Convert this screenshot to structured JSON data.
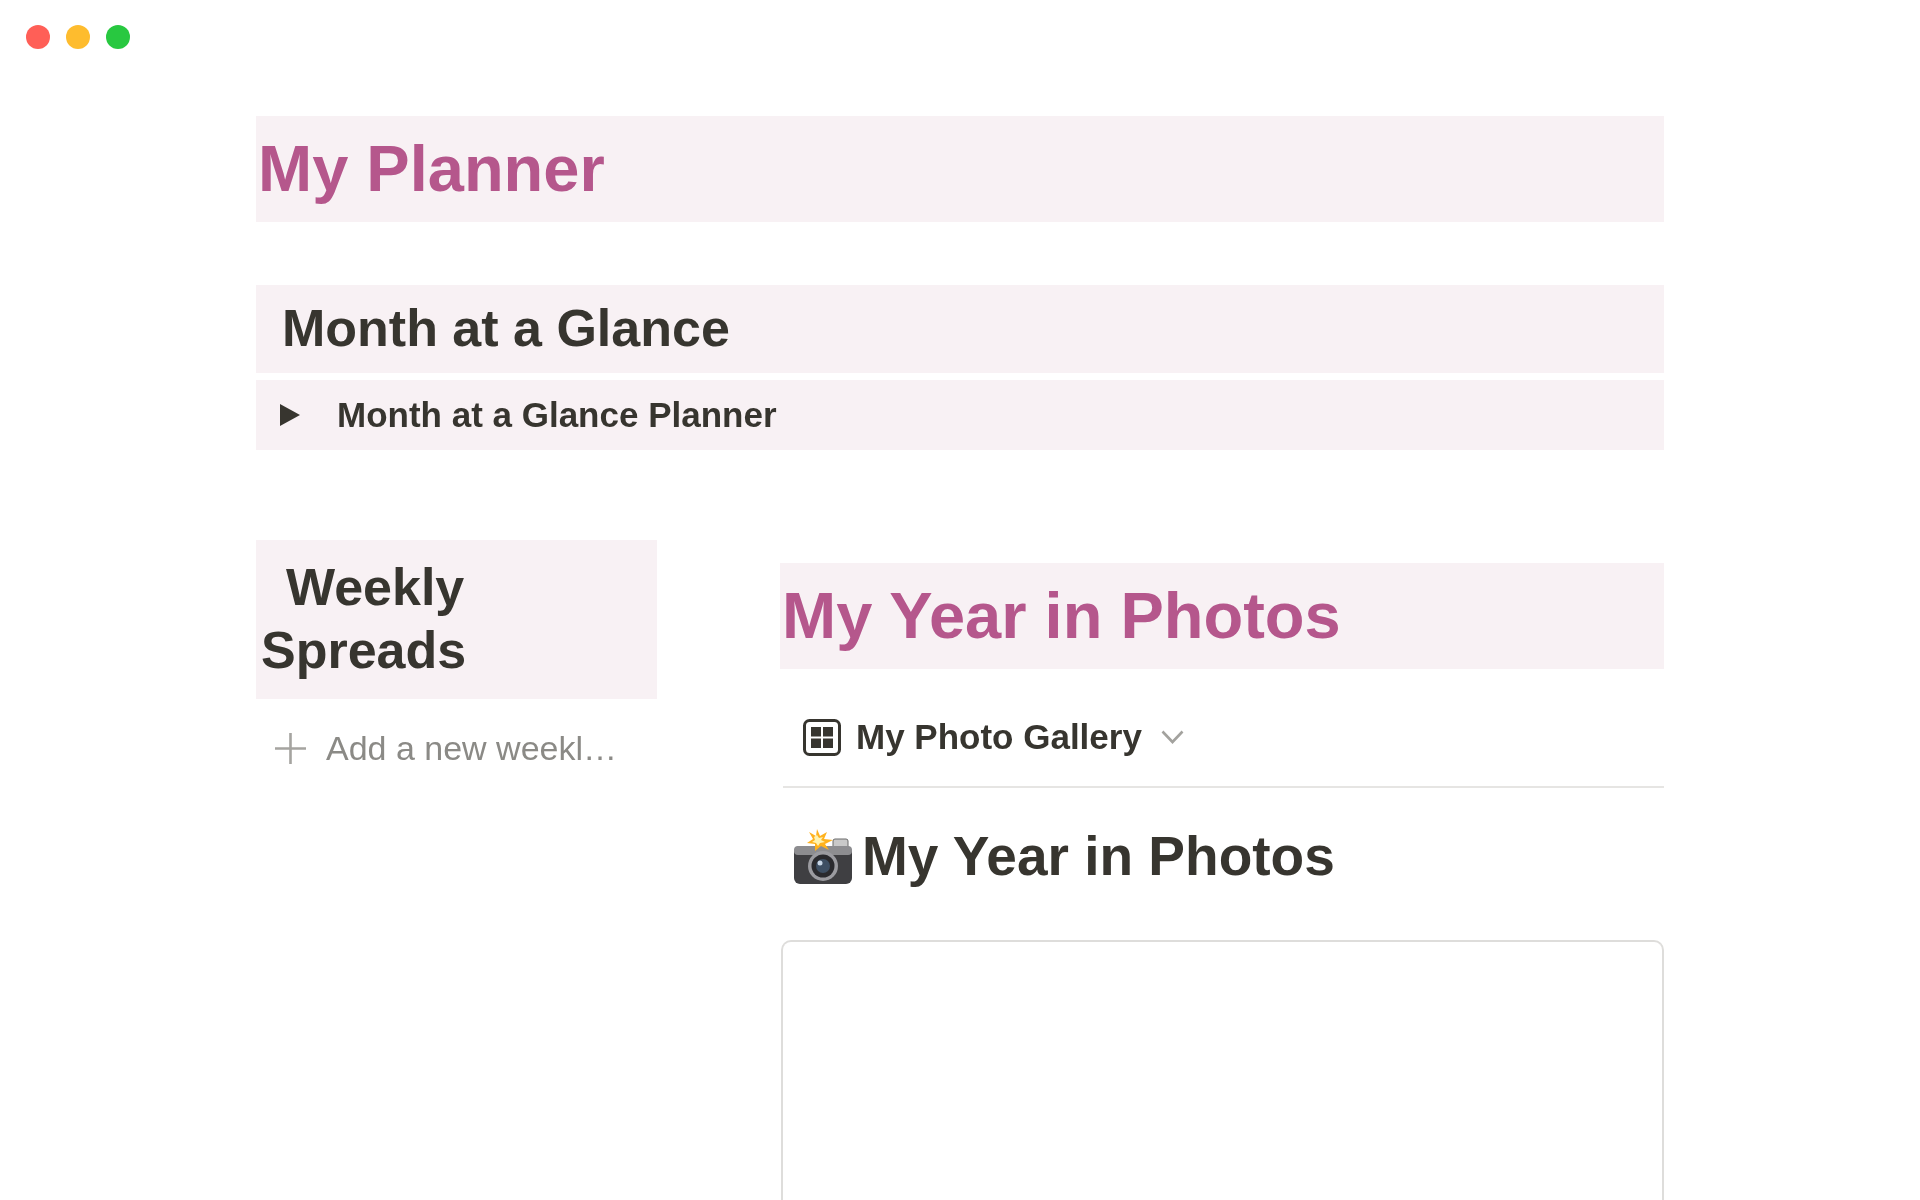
{
  "page_title": "My Planner",
  "month_at_a_glance": {
    "heading": "Month at a Glance",
    "toggle": {
      "label": "Month at a Glance Planner",
      "expanded": false
    }
  },
  "weekly_spreads": {
    "heading": "Weekly Spreads",
    "new_button": {
      "label": "Add a new weekl…"
    }
  },
  "photos": {
    "heading": "My Year in Photos",
    "view_select": {
      "label": "My Photo Gallery"
    },
    "gallery_title": "My Year in Photos"
  }
}
